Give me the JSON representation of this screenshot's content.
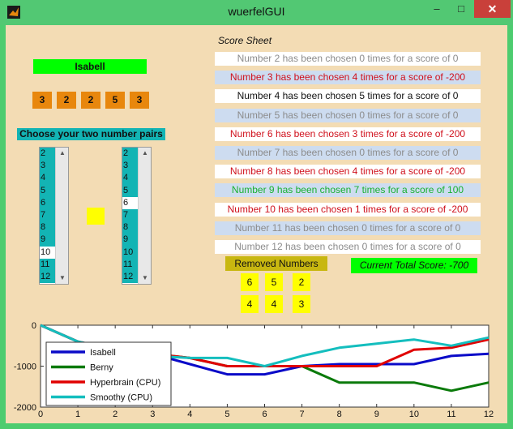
{
  "window": {
    "title": "wuerfelGUI",
    "minimize": "–",
    "maximize": "□",
    "close": "✕"
  },
  "player": {
    "name": "Isabell"
  },
  "dice": [
    "3",
    "2",
    "2",
    "5",
    "3"
  ],
  "choose_label": "Choose your two number pairs",
  "listboxes": [
    {
      "items": [
        "2",
        "3",
        "4",
        "5",
        "6",
        "7",
        "8",
        "9",
        "10",
        "11",
        "12"
      ],
      "selected": "10"
    },
    {
      "items": [
        "2",
        "3",
        "4",
        "5",
        "6",
        "7",
        "8",
        "9",
        "10",
        "11",
        "12"
      ],
      "selected": "6"
    }
  ],
  "score_sheet": {
    "title": "Score Sheet",
    "rows": [
      {
        "text": "Number 2 has been chosen 0 times for a score of 0",
        "color": "#8c8c8c",
        "bg": "#ffffff"
      },
      {
        "text": "Number 3 has been chosen 4 times for a score of -200",
        "color": "#d0101c",
        "bg": "#cddcf0"
      },
      {
        "text": "Number 4 has been chosen 5 times for a score of 0",
        "color": "#111111",
        "bg": "#ffffff"
      },
      {
        "text": "Number 5 has been chosen 0 times for a score of 0",
        "color": "#8c8c8c",
        "bg": "#cddcf0"
      },
      {
        "text": "Number 6 has been chosen 3 times for a score of -200",
        "color": "#d0101c",
        "bg": "#ffffff"
      },
      {
        "text": "Number 7 has been chosen 0 times for a score of 0",
        "color": "#8c8c8c",
        "bg": "#cddcf0"
      },
      {
        "text": "Number 8 has been chosen 4 times for a score of -200",
        "color": "#d0101c",
        "bg": "#ffffff"
      },
      {
        "text": "Number 9 has been chosen 7 times for a score of 100",
        "color": "#18b030",
        "bg": "#cddcf0"
      },
      {
        "text": "Number 10 has been chosen 1 times for a score of -200",
        "color": "#d0101c",
        "bg": "#ffffff"
      },
      {
        "text": "Number 11 has been chosen 0 times for a score of 0",
        "color": "#8c8c8c",
        "bg": "#cddcf0"
      },
      {
        "text": "Number 12 has been chosen 0 times for a score of 0",
        "color": "#8c8c8c",
        "bg": "#ffffff"
      }
    ]
  },
  "removed": {
    "label": "Removed Numbers",
    "numbers": [
      "6",
      "5",
      "2",
      "4",
      "4",
      "3"
    ]
  },
  "total_score": "Current Total Score: -700",
  "chart_data": {
    "type": "line",
    "x": [
      0,
      1,
      2,
      3,
      4,
      5,
      6,
      7,
      8,
      9,
      10,
      11,
      12
    ],
    "xlim": [
      0,
      12
    ],
    "ylim": [
      -2000,
      0
    ],
    "xticks": [
      "0",
      "1",
      "2",
      "3",
      "4",
      "5",
      "6",
      "7",
      "8",
      "9",
      "10",
      "11",
      "12"
    ],
    "yticks": [
      {
        "value": 0,
        "label": "0"
      },
      {
        "value": -1000,
        "label": "-1000"
      },
      {
        "value": -2000,
        "label": "-2000"
      }
    ],
    "grid": false,
    "legend_position": "bottom-left",
    "series": [
      {
        "name": "Isabell",
        "color": "#0a0ac8",
        "values": [
          0,
          -400,
          -600,
          -700,
          -950,
          -1200,
          -1200,
          -1000,
          -950,
          -950,
          -950,
          -750,
          -700
        ]
      },
      {
        "name": "Berny",
        "color": "#0a7a0a",
        "values": [
          0,
          -400,
          -600,
          -700,
          -800,
          -1000,
          -1000,
          -1000,
          -1400,
          -1400,
          -1400,
          -1600,
          -1400
        ]
      },
      {
        "name": "Hyperbrain (CPU)",
        "color": "#e00000",
        "values": [
          0,
          -400,
          -600,
          -700,
          -800,
          -1000,
          -1000,
          -1000,
          -1000,
          -1000,
          -600,
          -550,
          -350
        ]
      },
      {
        "name": "Smoothy (CPU)",
        "color": "#14bebe",
        "values": [
          0,
          -400,
          -600,
          -750,
          -800,
          -800,
          -1000,
          -750,
          -550,
          -450,
          -350,
          -500,
          -300
        ]
      }
    ]
  }
}
